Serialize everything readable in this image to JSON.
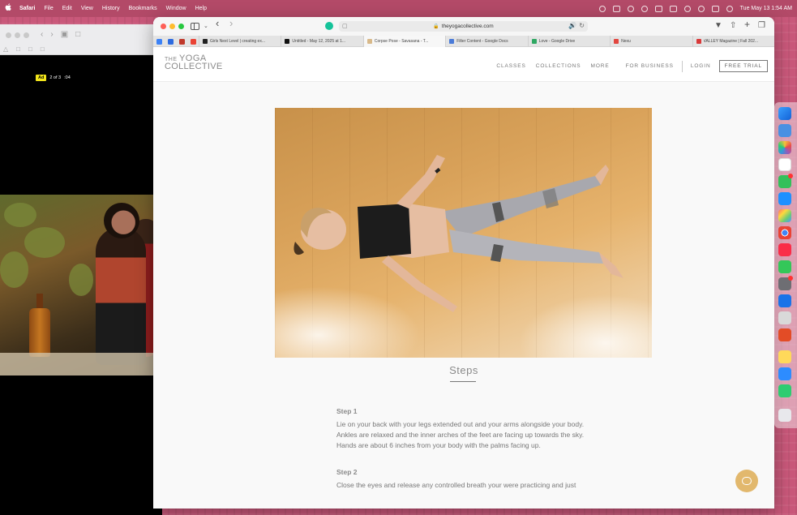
{
  "menubar": {
    "app": "Safari",
    "items": [
      "File",
      "Edit",
      "View",
      "History",
      "Bookmarks",
      "Window",
      "Help"
    ],
    "clock": "Tue May 13  1:54 AM"
  },
  "back_window": {
    "ad_label": "Ad",
    "ad_count": "2 of 3",
    "ad_time": ":04"
  },
  "browser": {
    "url": "theyogacollective.com",
    "tabs": [
      {
        "label": "Girls Next Level | creating ex...",
        "color": "#222222"
      },
      {
        "label": "Untitled - May 12, 2025 at 1...",
        "color": "#111111"
      },
      {
        "label": "Corpse Pose - Savasana - T...",
        "color": "#d8b98a",
        "active": true
      },
      {
        "label": "Filter Content - Google Docs",
        "color": "#4a7bd8"
      },
      {
        "label": "Love - Google Drive",
        "color": "#2fa863"
      },
      {
        "label": "Nexu",
        "color": "#e2463f"
      },
      {
        "label": "VALLEY Magazine | Fall 202...",
        "color": "#d93a3a"
      }
    ]
  },
  "site": {
    "logo_line1_prefix": "THE",
    "logo_line1_word": "YOGA",
    "logo_line2": "COLLECTIVE",
    "nav": {
      "classes": "CLASSES",
      "collections": "COLLECTIONS",
      "more": "MORE",
      "business": "FOR BUSINESS",
      "login": "LOGIN",
      "trial": "FREE TRIAL"
    }
  },
  "article": {
    "steps_title": "Steps",
    "steps": [
      {
        "heading": "Step 1",
        "lines": [
          "Lie on your back with your legs extended out and your arms alongside your body.",
          "Ankles are relaxed and the inner arches of the feet are facing up towards the sky.",
          "Hands are about 6 inches from your body with the palms facing up."
        ]
      },
      {
        "heading": "Step 2",
        "lines": [
          "Close the eyes and release any controlled breath your were practicing and just"
        ]
      }
    ]
  }
}
